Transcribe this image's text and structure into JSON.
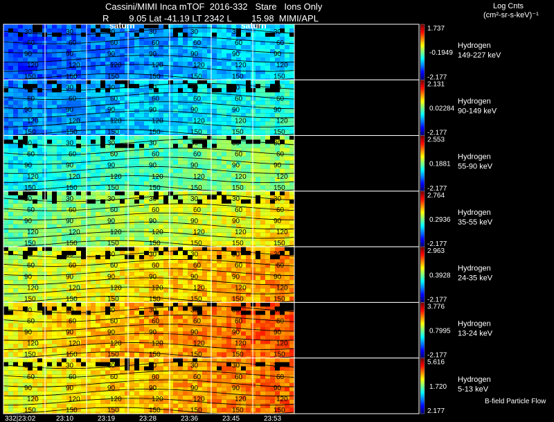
{
  "header": {
    "line1": "Cassini/MIMI Inca mTOF  2016-332   Stare   Ions Only",
    "line2": "R        9.05 Lat -41.19 LT 2342 L        15.98  MIMI/APL",
    "units_title": "Log Cnts",
    "units_sub": "(cm²-sr-s-keV)⁻¹",
    "saturn_left": "saturn",
    "saturn_right": "saturn",
    "bfield_note": "B-field Particle Flow"
  },
  "chart_data": {
    "type": "heatmap",
    "x_ticks": [
      "332|23:02",
      "23:10",
      "23:19",
      "23:28",
      "23:36",
      "23:45",
      "23:53"
    ],
    "contour_labels": [
      "30",
      "60",
      "90",
      "120",
      "150"
    ],
    "panels": [
      {
        "species": "Hydrogen",
        "energy": "149-227 keV",
        "max": "1.737",
        "mid": "-0.1949",
        "min": "-2.177",
        "level": 0.18
      },
      {
        "species": "Hydrogen",
        "energy": "90-149 keV",
        "max": "2.131",
        "mid": "0.02284",
        "min": "-2.177",
        "level": 0.24
      },
      {
        "species": "Hydrogen",
        "energy": "55-90 keV",
        "max": "2.553",
        "mid": "0.1881",
        "min": "-2.177",
        "level": 0.36
      },
      {
        "species": "Hydrogen",
        "energy": "35-55 keV",
        "max": "2.764",
        "mid": "0.2936",
        "min": "-2.177",
        "level": 0.47
      },
      {
        "species": "Hydrogen",
        "energy": "24-35 keV",
        "max": "2.963",
        "mid": "0.3928",
        "min": "-2.177",
        "level": 0.56
      },
      {
        "species": "Hydrogen",
        "energy": "13-24 keV",
        "max": "3.776",
        "mid": "0.7995",
        "min": "-2.177",
        "level": 0.62
      },
      {
        "species": "Hydrogen",
        "energy": "5-13 keV",
        "max": "5.616",
        "mid": "1.720",
        "min": "2.177",
        "level": 0.6
      }
    ]
  }
}
